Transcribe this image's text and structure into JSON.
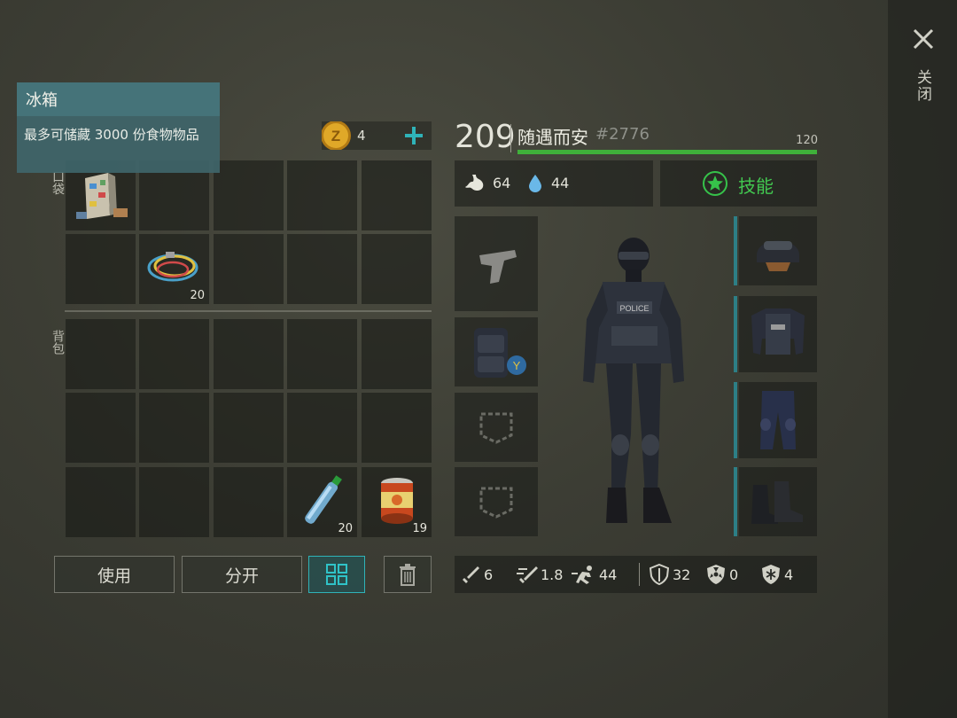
{
  "tooltip": {
    "title": "冰箱",
    "description": "最多可储藏 3000 份食物物品"
  },
  "sidebar": {
    "close_label": "关闭"
  },
  "inventory": {
    "pockets_label": "口袋",
    "backpack_label": "背包",
    "coins": "4",
    "slots": {
      "hose_count": "20",
      "water_count": "20",
      "canned_food_count": "19"
    }
  },
  "actions": {
    "use_label": "使用",
    "split_label": "分开"
  },
  "character": {
    "level": "209",
    "name": "随遇而安",
    "id": "#2776",
    "xp_max": "120",
    "xp_fill_fraction": 1.0,
    "hunger": "64",
    "thirst": "44",
    "skills_label": "技能"
  },
  "stats": {
    "attack": "6",
    "attack_speed": "1.8",
    "speed": "44",
    "armor": "32",
    "radiation": "0",
    "cold": "4"
  },
  "colors": {
    "accent_teal": "#2fb3b8",
    "xp_green": "#3fb03a",
    "coin_gold": "#e0a828",
    "tooltip_teal": "#457379"
  }
}
